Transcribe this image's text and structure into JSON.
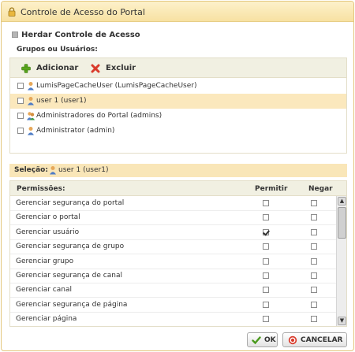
{
  "window": {
    "title": "Controle de Acesso do Portal",
    "icon": "lock-icon"
  },
  "inherit": {
    "label": "Herdar Controle de Acesso",
    "checked": false
  },
  "groups": {
    "label": "Grupos ou Usuários:",
    "toolbar": {
      "add_label": "Adicionar",
      "delete_label": "Excluir"
    },
    "items": [
      {
        "label": "LumisPageCacheUser (LumisPageCacheUser)",
        "icon": "user-icon",
        "selected": false
      },
      {
        "label": "user 1 (user1)",
        "icon": "user-icon",
        "selected": true
      },
      {
        "label": "Administradores do Portal (admins)",
        "icon": "group-icon",
        "selected": false
      },
      {
        "label": "Administrator (admin)",
        "icon": "user-icon",
        "selected": false
      }
    ]
  },
  "selection": {
    "label": "Seleção:",
    "value": "user 1 (user1)"
  },
  "permissions": {
    "header": {
      "name": "Permissões:",
      "allow": "Permitir",
      "deny": "Negar"
    },
    "rows": [
      {
        "name": "Gerenciar segurança do portal",
        "allow": false,
        "deny": false
      },
      {
        "name": "Gerenciar o portal",
        "allow": false,
        "deny": false
      },
      {
        "name": "Gerenciar usuário",
        "allow": true,
        "deny": false
      },
      {
        "name": "Gerenciar segurança de grupo",
        "allow": false,
        "deny": false
      },
      {
        "name": "Gerenciar grupo",
        "allow": false,
        "deny": false
      },
      {
        "name": "Gerenciar segurança de canal",
        "allow": false,
        "deny": false
      },
      {
        "name": "Gerenciar canal",
        "allow": false,
        "deny": false
      },
      {
        "name": "Gerenciar segurança de página",
        "allow": false,
        "deny": false
      },
      {
        "name": "Gerenciar página",
        "allow": false,
        "deny": false
      }
    ]
  },
  "buttons": {
    "ok_label": "OK",
    "cancel_label": "CANCELAR"
  },
  "colors": {
    "title_bar": "#f7e1a2",
    "selected_row": "#fbe8bd",
    "toolbar": "#f1f0e2",
    "add_icon": "#5aa51e",
    "delete_icon": "#d93a2b"
  }
}
